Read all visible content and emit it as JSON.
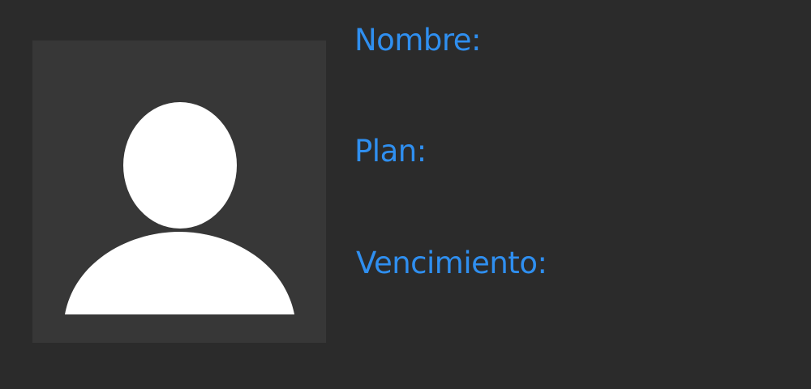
{
  "profile": {
    "avatar_icon": "user-silhouette-icon",
    "fields": {
      "nombre_label": "Nombre:",
      "plan_label": "Plan:",
      "vencimiento_label": "Vencimiento:"
    }
  },
  "colors": {
    "background": "#2b2b2b",
    "avatar_background": "#373737",
    "avatar_silhouette": "#ffffff",
    "label_accent": "#2f8ff0"
  }
}
